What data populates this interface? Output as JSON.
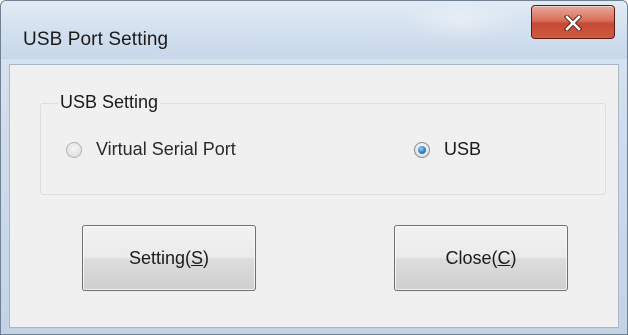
{
  "window": {
    "title": "USB Port Setting"
  },
  "group": {
    "label": "USB Setting",
    "options": [
      {
        "label": "Virtual Serial Port",
        "checked": false
      },
      {
        "label": "USB",
        "checked": true
      }
    ]
  },
  "buttons": {
    "setting_text": "Setting(",
    "setting_key": "S",
    "setting_end": ")",
    "close_text": "Close(",
    "close_key": "C",
    "close_end": ")"
  },
  "colors": {
    "titlebar": "#d3e0ee",
    "close_button": "#c64a33",
    "client_background": "#f0f0f0",
    "radio_selected": "#2a83c8"
  },
  "icons": {
    "close": "close-x-icon"
  }
}
